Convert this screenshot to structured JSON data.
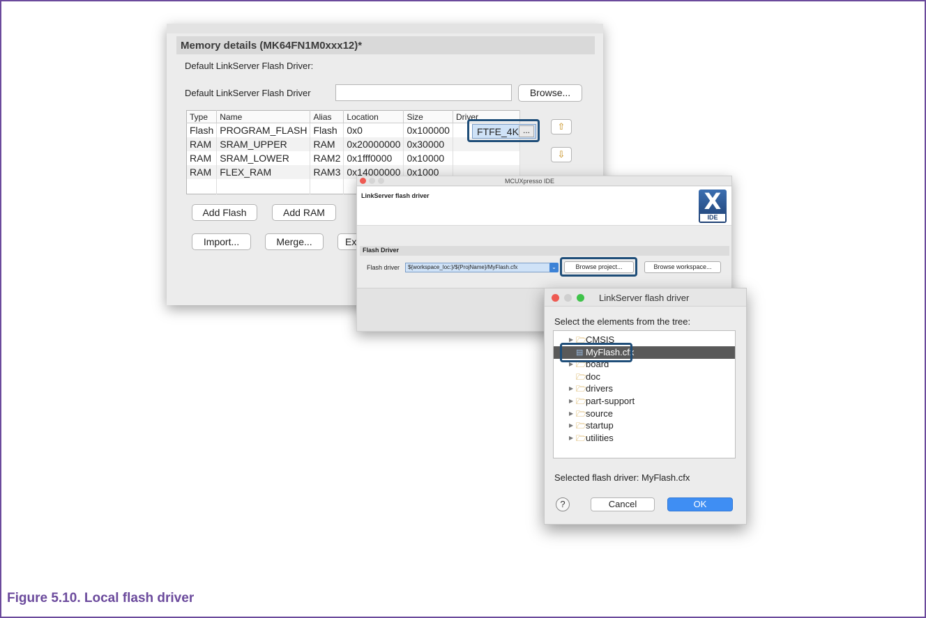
{
  "memory_window": {
    "header": "Memory details (MK64FN1M0xxx12)*",
    "default_driver_heading": "Default LinkServer Flash Driver:",
    "default_driver_label": "Default LinkServer Flash Driver",
    "default_driver_value": "",
    "browse_label": "Browse...",
    "columns": [
      "Type",
      "Name",
      "Alias",
      "Location",
      "Size",
      "Driver"
    ],
    "rows": [
      {
        "type": "Flash",
        "name": "PROGRAM_FLASH",
        "alias": "Flash",
        "location": "0x0",
        "size": "0x100000",
        "driver": "FTFE_4K"
      },
      {
        "type": "RAM",
        "name": "SRAM_UPPER",
        "alias": "RAM",
        "location": "0x20000000",
        "size": "0x30000",
        "driver": ""
      },
      {
        "type": "RAM",
        "name": "SRAM_LOWER",
        "alias": "RAM2",
        "location": "0x1fff0000",
        "size": "0x10000",
        "driver": ""
      },
      {
        "type": "RAM",
        "name": "FLEX_RAM",
        "alias": "RAM3",
        "location": "0x14000000",
        "size": "0x1000",
        "driver": ""
      }
    ],
    "driver_cell_text": "FTFE_4K",
    "ellipsis": "...",
    "add_flash": "Add Flash",
    "add_ram": "Add RAM",
    "import": "Import...",
    "merge": "Merge...",
    "export_partial": "Ex"
  },
  "ide_window": {
    "window_title": "MCUXpresso IDE",
    "dialog_title": "LinkServer flash driver",
    "logo_letter": "X",
    "logo_text": "IDE",
    "section": "Flash Driver",
    "flash_driver_label": "Flash driver",
    "flash_driver_value": "${workspace_loc:}/${ProjName}/MyFlash.cfx",
    "browse_project": "Browse project...",
    "browse_workspace": "Browse workspace..."
  },
  "picker_window": {
    "title": "LinkServer flash driver",
    "prompt": "Select the elements from the tree:",
    "tree": [
      {
        "label": "CMSIS",
        "kind": "folder",
        "expandable": true,
        "indent": 0
      },
      {
        "label": "MyFlash.cfx",
        "kind": "file",
        "expandable": false,
        "indent": 0,
        "selected": true
      },
      {
        "label": "board",
        "kind": "folder",
        "expandable": true,
        "indent": 0
      },
      {
        "label": "doc",
        "kind": "folder",
        "expandable": false,
        "indent": 0
      },
      {
        "label": "drivers",
        "kind": "folder",
        "expandable": true,
        "indent": 0
      },
      {
        "label": "part-support",
        "kind": "folder",
        "expandable": true,
        "indent": 0
      },
      {
        "label": "source",
        "kind": "folder",
        "expandable": true,
        "indent": 0
      },
      {
        "label": "startup",
        "kind": "folder",
        "expandable": true,
        "indent": 0
      },
      {
        "label": "utilities",
        "kind": "folder",
        "expandable": true,
        "indent": 0
      }
    ],
    "selected_info": "Selected flash driver: MyFlash.cfx",
    "help": "?",
    "cancel": "Cancel",
    "ok": "OK"
  },
  "caption": "Figure 5.10. Local flash driver",
  "colors": {
    "caption": "#6b4a9c",
    "highlight": "#1f4e79",
    "ok_button": "#3f8ef3"
  }
}
